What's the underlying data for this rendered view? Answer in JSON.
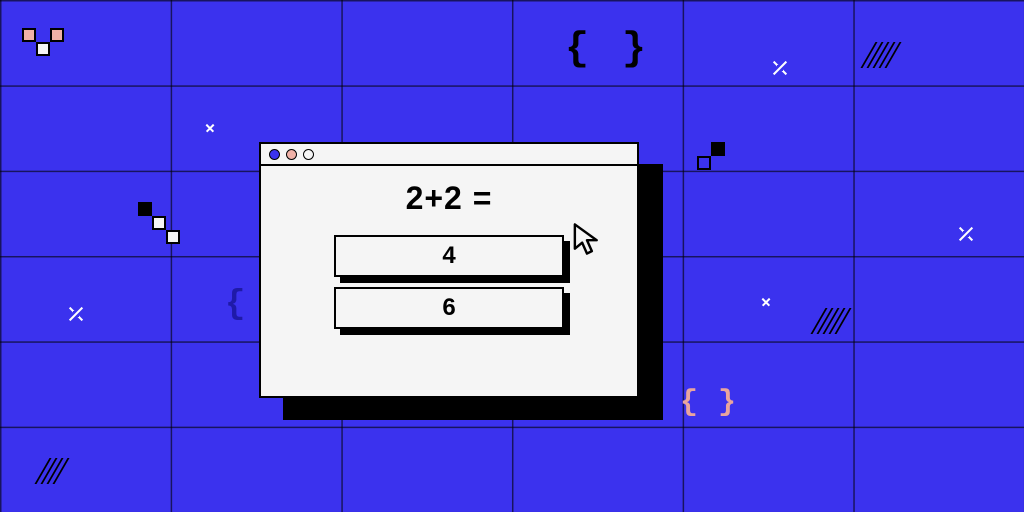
{
  "quiz": {
    "question": "2+2 =",
    "answers": [
      "4",
      "6"
    ]
  },
  "decor": {
    "braces_black_left": "{",
    "braces_black_right": "}",
    "braces_pink_left": "{",
    "braces_pink_right": "}",
    "brace_blue_left": "{"
  }
}
